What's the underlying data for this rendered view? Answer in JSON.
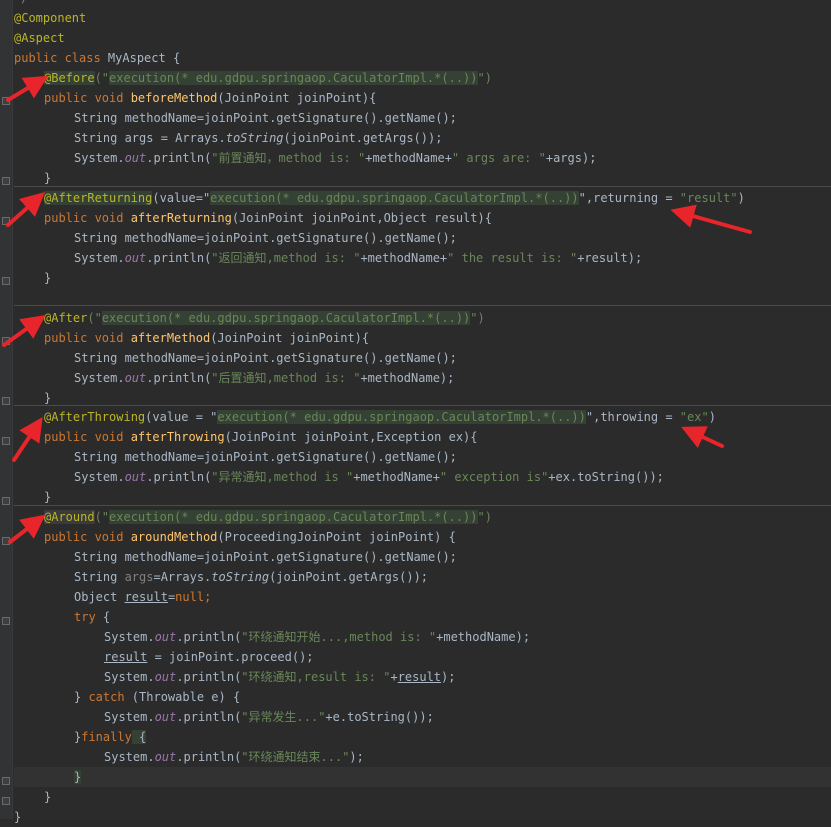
{
  "code": {
    "top_fragment": "*/",
    "component": "@Component",
    "aspect": "@Aspect",
    "class_decl": {
      "kw": "public class ",
      "name": "MyAspect {"
    },
    "before": {
      "ann": "@Before",
      "paren_open": "(\"",
      "expr": "execution(* edu.gdpu.springaop.CaculatorImpl.*(..))",
      "paren_close": "\")",
      "sig_kw": "public void ",
      "sig_name": "beforeMethod",
      "sig_rest": "(JoinPoint joinPoint){",
      "line1": "String methodName=joinPoint.getSignature().getName();",
      "line2a": "String args = Arrays.",
      "line2b": "toString",
      "line2c": "(joinPoint.getArgs());",
      "line3a": "System.",
      "line3b": "out",
      "line3c": ".println(",
      "line3d": "\"前置通知，method is: \"",
      "line3e": "+methodName+",
      "line3f": "\" args are: \"",
      "line3g": "+args);",
      "close": "}"
    },
    "after_returning": {
      "ann": "@AfterReturning",
      "open": "(value=\"",
      "expr": "execution(* edu.gdpu.springaop.CaculatorImpl.*(..))",
      "mid": "\",returning = ",
      "val": "\"result\"",
      "end": ")",
      "sig_kw": "public void ",
      "sig_name": "afterReturning",
      "sig_rest": "(JoinPoint joinPoint,Object result){",
      "line1": "String methodName=joinPoint.getSignature().getName();",
      "line2a": "System.",
      "line2b": "out",
      "line2c": ".println(",
      "line2d": "\"返回通知,method is: \"",
      "line2e": "+methodName+",
      "line2f": "\" the result is: \"",
      "line2g": "+result);",
      "close": "}"
    },
    "after": {
      "ann": "@After",
      "paren_open": "(\"",
      "expr": "execution(* edu.gdpu.springaop.CaculatorImpl.*(..))",
      "paren_close": "\")",
      "sig_kw": "public void ",
      "sig_name": "afterMethod",
      "sig_rest": "(JoinPoint joinPoint){",
      "line1": "String methodName=joinPoint.getSignature().getName();",
      "line2a": "System.",
      "line2b": "out",
      "line2c": ".println(",
      "line2d": "\"后置通知,method is: \"",
      "line2e": "+methodName);",
      "close": "}"
    },
    "after_throwing": {
      "ann": "@AfterThrowing",
      "open": "(value = \"",
      "expr": "execution(* edu.gdpu.springaop.CaculatorImpl.*(..))",
      "mid": "\",throwing = ",
      "val": "\"ex\"",
      "end": ")",
      "sig_kw": "public void ",
      "sig_name": "afterThrowing",
      "sig_rest": "(JoinPoint joinPoint,Exception ex){",
      "line1": "String methodName=joinPoint.getSignature().getName();",
      "line2a": "System.",
      "line2b": "out",
      "line2c": ".println(",
      "line2d": "\"异常通知,method is \"",
      "line2e": "+methodName+",
      "line2f": "\" exception is\"",
      "line2g": "+ex.toString());",
      "close": "}"
    },
    "around": {
      "ann": "@Around",
      "paren_open": "(\"",
      "expr": "execution(* edu.gdpu.springaop.CaculatorImpl.*(..))",
      "paren_close": "\")",
      "sig_kw": "public void ",
      "sig_name": "aroundMethod",
      "sig_rest": "(ProceedingJoinPoint joinPoint) {",
      "line1": "String methodName=joinPoint.getSignature().getName();",
      "line2a": "String ",
      "line2b": "args",
      "line2c": "=Arrays.",
      "line2d": "toString",
      "line2e": "(joinPoint.getArgs());",
      "line3a": "Object ",
      "line3b": "result",
      "line3c": "=",
      "line3d": "null",
      "line3e": ";",
      "try_kw": "try",
      "try_rest": " {",
      "t1a": "System.",
      "t1b": "out",
      "t1c": ".println(",
      "t1d": "\"环绕通知开始...,method is: \"",
      "t1e": "+methodName);",
      "t2a": "result",
      "t2b": " = joinPoint.proceed();",
      "t3a": "System.",
      "t3b": "out",
      "t3c": ".println(",
      "t3d": "\"环绕通知,result is: \"",
      "t3e": "+",
      "t3f": "result",
      "t3g": ");",
      "catch_a": "} ",
      "catch_kw": "catch",
      "catch_b": " (Throwable e) {",
      "c1a": "System.",
      "c1b": "out",
      "c1c": ".println(",
      "c1d": "\"异常发生...\"",
      "c1e": "+e.toString());",
      "finally_a": "}",
      "finally_kw": "finally",
      "finally_b": " {",
      "f1a": "System.",
      "f1b": "out",
      "f1c": ".println(",
      "f1d": "\"环绕通知结束...\"",
      "f1e": ");",
      "close_finally": "}",
      "close_method": "}",
      "close_class": "}"
    }
  },
  "colors": {
    "background": "#2b2b2b",
    "keyword": "#cc7832",
    "annotation": "#bbb529",
    "string": "#6a8759",
    "method": "#ffc66d",
    "static_field": "#9876aa",
    "arrow": "#e8252a"
  },
  "icons": [
    "red-arrow-icon"
  ]
}
